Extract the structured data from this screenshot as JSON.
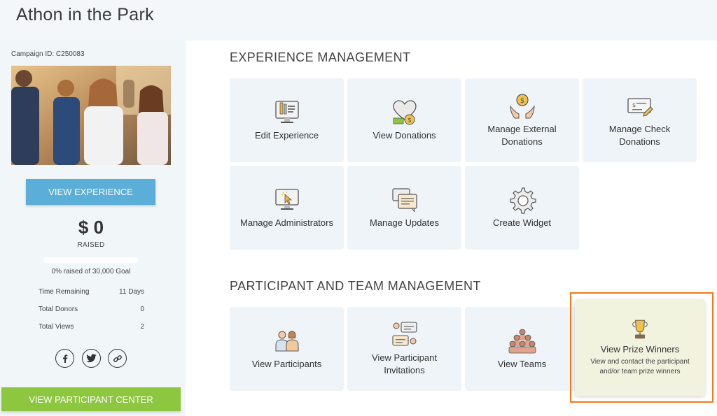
{
  "header": {
    "title": "Athon in the Park"
  },
  "sidebar": {
    "campaign_id": "Campaign ID: C250083",
    "view_experience_label": "VIEW EXPERIENCE",
    "raised_amount": "$ 0",
    "raised_label": "RAISED",
    "progress_percent": 0,
    "goal_text": "0% raised of 30,000 Goal",
    "stats": [
      {
        "label": "Time Remaining",
        "value": "11 Days"
      },
      {
        "label": "Total Donors",
        "value": "0"
      },
      {
        "label": "Total Views",
        "value": "2"
      }
    ],
    "social_icons": [
      "facebook-icon",
      "twitter-icon",
      "link-icon"
    ],
    "participant_center_label": "VIEW PARTICIPANT CENTER"
  },
  "experience_management": {
    "title": "EXPERIENCE MANAGEMENT",
    "tiles": [
      {
        "label": "Edit Experience",
        "icon": "edit-screen-icon"
      },
      {
        "label": "View Donations",
        "icon": "heart-coin-icon"
      },
      {
        "label": "Manage External Donations",
        "icon": "hands-coin-icon"
      },
      {
        "label": "Manage Check Donations",
        "icon": "check-pen-icon"
      },
      {
        "label": "Manage Administrators",
        "icon": "monitor-cursor-icon"
      },
      {
        "label": "Manage Updates",
        "icon": "chat-bubbles-icon"
      },
      {
        "label": "Create Widget",
        "icon": "gear-icon"
      }
    ]
  },
  "participant_team_management": {
    "title": "PARTICIPANT AND TEAM MANAGEMENT",
    "tiles": [
      {
        "label": "View Participants",
        "icon": "people-icon"
      },
      {
        "label": "View Participant Invitations",
        "icon": "invitation-chat-icon"
      },
      {
        "label": "View Teams",
        "icon": "team-group-icon"
      },
      {
        "label": "View Prize Winners",
        "icon": "trophy-icon",
        "description": "View and contact the participant and/or team prize winners"
      }
    ]
  },
  "colors": {
    "accent_blue": "#5aaed8",
    "accent_green": "#8dc63f",
    "tile_bg": "#eef4f8",
    "highlight_border": "#f07a1a"
  }
}
